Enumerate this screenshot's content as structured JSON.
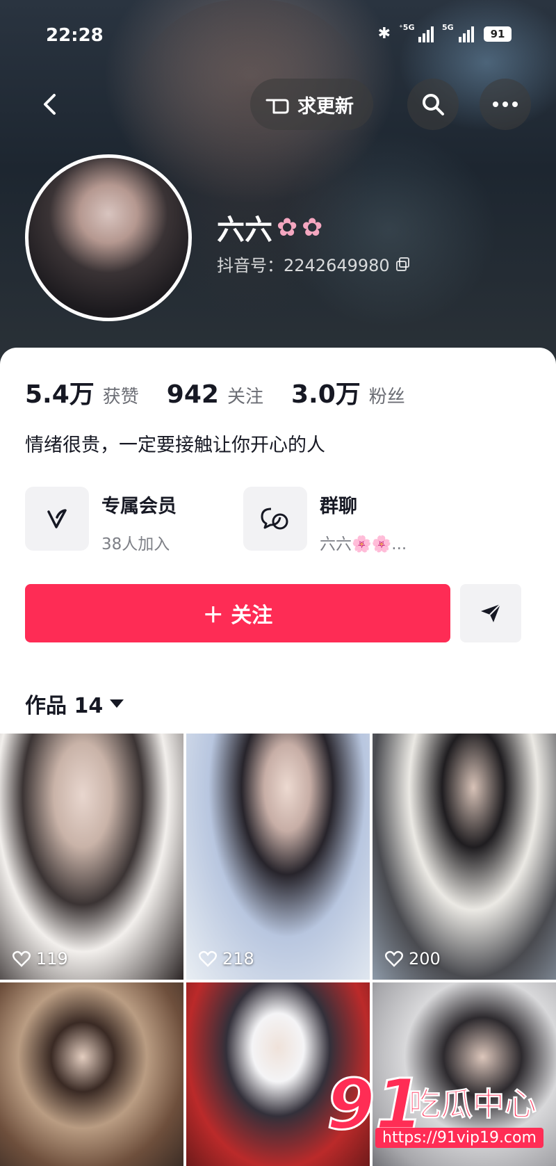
{
  "status_bar": {
    "time": "22:28",
    "net1": "⁺5G",
    "net2": "5G",
    "battery": "91"
  },
  "nav": {
    "update_label": "求更新"
  },
  "profile": {
    "name": "六六",
    "douyin_id": "抖音号：2242649980"
  },
  "stats": [
    {
      "num": "5.4万",
      "label": "获赞"
    },
    {
      "num": "942",
      "label": "关注"
    },
    {
      "num": "3.0万",
      "label": "粉丝"
    }
  ],
  "bio": "情绪很贵，一定要接触让你开心的人",
  "member": {
    "title": "专属会员",
    "sub": "38人加入"
  },
  "group": {
    "title": "群聊",
    "sub": "六六🌸🌸..."
  },
  "follow_label": "＋ 关注",
  "works": {
    "label": "作品 14"
  },
  "grid": [
    {
      "likes": "119"
    },
    {
      "likes": "218"
    },
    {
      "likes": "200"
    }
  ],
  "watermark": {
    "num": "91",
    "cn": "吃瓜中心",
    "url": "https://91vip19.com"
  },
  "colors": {
    "accent": "#fe2c55",
    "text": "#161823",
    "muted": "#6b6d74"
  },
  "icons": [
    "back-icon",
    "pointing-hand-icon",
    "search-icon",
    "more-icon",
    "copy-icon",
    "member-v-icon",
    "chat-bubbles-icon",
    "share-icon",
    "heart-icon",
    "bluetooth-icon",
    "signal-icon",
    "battery-icon"
  ]
}
